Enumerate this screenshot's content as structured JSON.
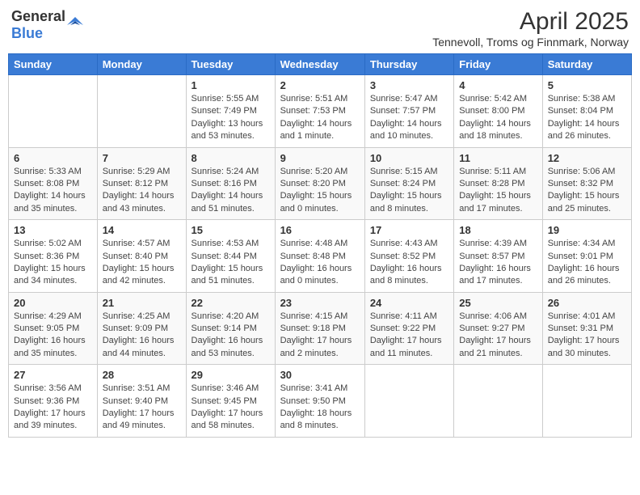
{
  "header": {
    "logo_general": "General",
    "logo_blue": "Blue",
    "title": "April 2025",
    "subtitle": "Tennevoll, Troms og Finnmark, Norway"
  },
  "weekdays": [
    "Sunday",
    "Monday",
    "Tuesday",
    "Wednesday",
    "Thursday",
    "Friday",
    "Saturday"
  ],
  "weeks": [
    [
      {
        "day": "",
        "info": ""
      },
      {
        "day": "",
        "info": ""
      },
      {
        "day": "1",
        "info": "Sunrise: 5:55 AM\nSunset: 7:49 PM\nDaylight: 13 hours and 53 minutes."
      },
      {
        "day": "2",
        "info": "Sunrise: 5:51 AM\nSunset: 7:53 PM\nDaylight: 14 hours and 1 minute."
      },
      {
        "day": "3",
        "info": "Sunrise: 5:47 AM\nSunset: 7:57 PM\nDaylight: 14 hours and 10 minutes."
      },
      {
        "day": "4",
        "info": "Sunrise: 5:42 AM\nSunset: 8:00 PM\nDaylight: 14 hours and 18 minutes."
      },
      {
        "day": "5",
        "info": "Sunrise: 5:38 AM\nSunset: 8:04 PM\nDaylight: 14 hours and 26 minutes."
      }
    ],
    [
      {
        "day": "6",
        "info": "Sunrise: 5:33 AM\nSunset: 8:08 PM\nDaylight: 14 hours and 35 minutes."
      },
      {
        "day": "7",
        "info": "Sunrise: 5:29 AM\nSunset: 8:12 PM\nDaylight: 14 hours and 43 minutes."
      },
      {
        "day": "8",
        "info": "Sunrise: 5:24 AM\nSunset: 8:16 PM\nDaylight: 14 hours and 51 minutes."
      },
      {
        "day": "9",
        "info": "Sunrise: 5:20 AM\nSunset: 8:20 PM\nDaylight: 15 hours and 0 minutes."
      },
      {
        "day": "10",
        "info": "Sunrise: 5:15 AM\nSunset: 8:24 PM\nDaylight: 15 hours and 8 minutes."
      },
      {
        "day": "11",
        "info": "Sunrise: 5:11 AM\nSunset: 8:28 PM\nDaylight: 15 hours and 17 minutes."
      },
      {
        "day": "12",
        "info": "Sunrise: 5:06 AM\nSunset: 8:32 PM\nDaylight: 15 hours and 25 minutes."
      }
    ],
    [
      {
        "day": "13",
        "info": "Sunrise: 5:02 AM\nSunset: 8:36 PM\nDaylight: 15 hours and 34 minutes."
      },
      {
        "day": "14",
        "info": "Sunrise: 4:57 AM\nSunset: 8:40 PM\nDaylight: 15 hours and 42 minutes."
      },
      {
        "day": "15",
        "info": "Sunrise: 4:53 AM\nSunset: 8:44 PM\nDaylight: 15 hours and 51 minutes."
      },
      {
        "day": "16",
        "info": "Sunrise: 4:48 AM\nSunset: 8:48 PM\nDaylight: 16 hours and 0 minutes."
      },
      {
        "day": "17",
        "info": "Sunrise: 4:43 AM\nSunset: 8:52 PM\nDaylight: 16 hours and 8 minutes."
      },
      {
        "day": "18",
        "info": "Sunrise: 4:39 AM\nSunset: 8:57 PM\nDaylight: 16 hours and 17 minutes."
      },
      {
        "day": "19",
        "info": "Sunrise: 4:34 AM\nSunset: 9:01 PM\nDaylight: 16 hours and 26 minutes."
      }
    ],
    [
      {
        "day": "20",
        "info": "Sunrise: 4:29 AM\nSunset: 9:05 PM\nDaylight: 16 hours and 35 minutes."
      },
      {
        "day": "21",
        "info": "Sunrise: 4:25 AM\nSunset: 9:09 PM\nDaylight: 16 hours and 44 minutes."
      },
      {
        "day": "22",
        "info": "Sunrise: 4:20 AM\nSunset: 9:14 PM\nDaylight: 16 hours and 53 minutes."
      },
      {
        "day": "23",
        "info": "Sunrise: 4:15 AM\nSunset: 9:18 PM\nDaylight: 17 hours and 2 minutes."
      },
      {
        "day": "24",
        "info": "Sunrise: 4:11 AM\nSunset: 9:22 PM\nDaylight: 17 hours and 11 minutes."
      },
      {
        "day": "25",
        "info": "Sunrise: 4:06 AM\nSunset: 9:27 PM\nDaylight: 17 hours and 21 minutes."
      },
      {
        "day": "26",
        "info": "Sunrise: 4:01 AM\nSunset: 9:31 PM\nDaylight: 17 hours and 30 minutes."
      }
    ],
    [
      {
        "day": "27",
        "info": "Sunrise: 3:56 AM\nSunset: 9:36 PM\nDaylight: 17 hours and 39 minutes."
      },
      {
        "day": "28",
        "info": "Sunrise: 3:51 AM\nSunset: 9:40 PM\nDaylight: 17 hours and 49 minutes."
      },
      {
        "day": "29",
        "info": "Sunrise: 3:46 AM\nSunset: 9:45 PM\nDaylight: 17 hours and 58 minutes."
      },
      {
        "day": "30",
        "info": "Sunrise: 3:41 AM\nSunset: 9:50 PM\nDaylight: 18 hours and 8 minutes."
      },
      {
        "day": "",
        "info": ""
      },
      {
        "day": "",
        "info": ""
      },
      {
        "day": "",
        "info": ""
      }
    ]
  ]
}
